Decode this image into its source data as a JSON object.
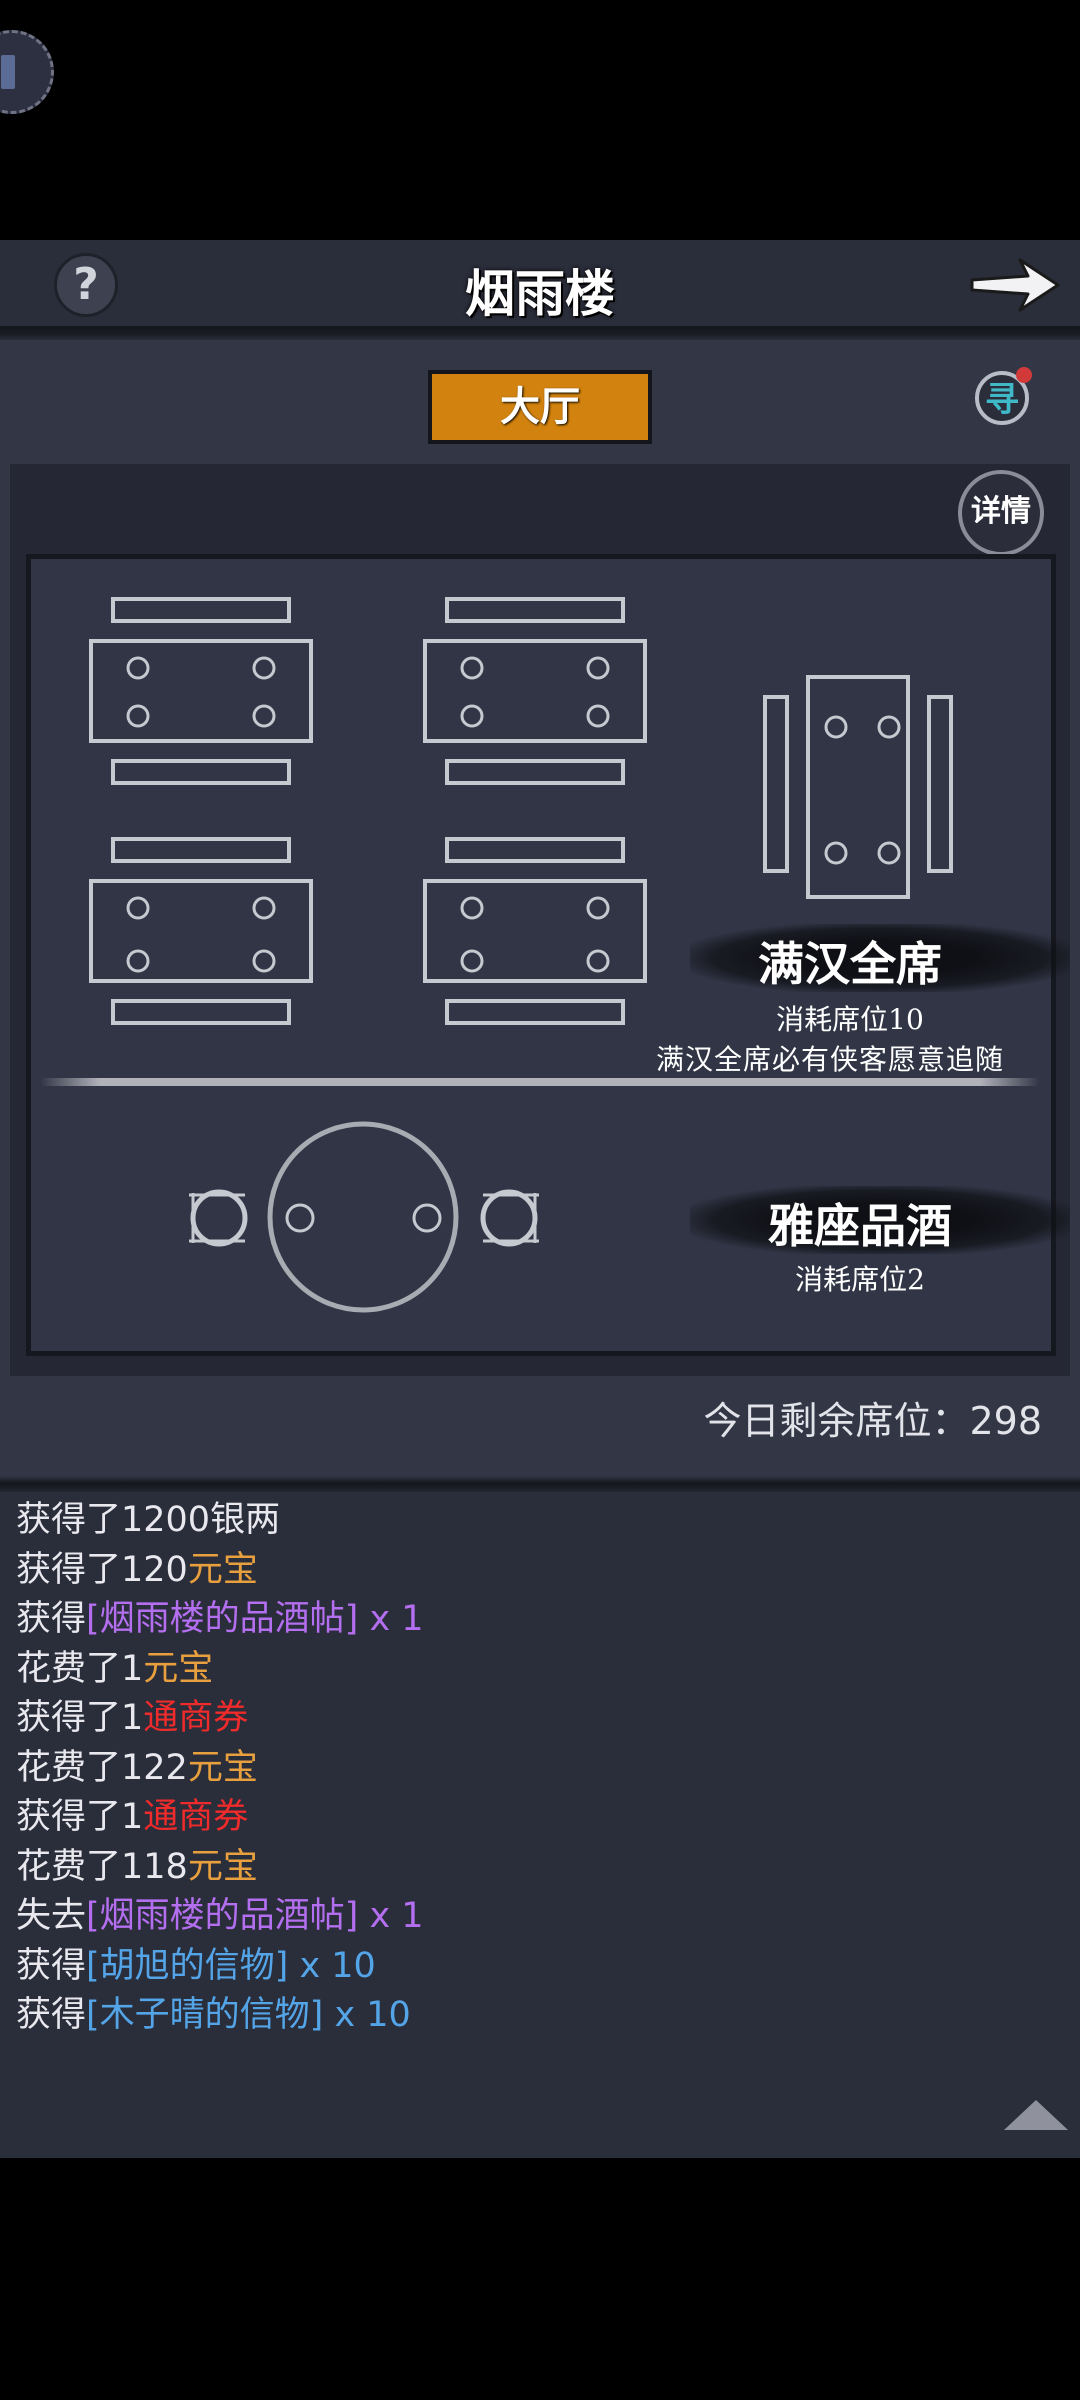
{
  "header": {
    "title": "烟雨楼",
    "help_icon": "question-mark-icon",
    "back_icon": "right-arrow-icon"
  },
  "tab": {
    "label": "大厅",
    "color": "#d2820e"
  },
  "search_badge": {
    "icon": "search-badge-icon",
    "glyph": "寻",
    "has_notification_dot": true
  },
  "details_button": {
    "label": "详情"
  },
  "feast": {
    "title": "满汉全席",
    "cost": "消耗席位10",
    "description": "满汉全席必有侠客愿意追随"
  },
  "wine": {
    "title": "雅座品酒",
    "cost": "消耗席位2"
  },
  "seats": {
    "label": "今日剩余席位：",
    "value": "298"
  },
  "log": [
    [
      {
        "text": "获得了1200银两",
        "color": "white"
      }
    ],
    [
      {
        "text": "获得了120",
        "color": "white"
      },
      {
        "text": "元宝",
        "color": "gold"
      }
    ],
    [
      {
        "text": "获得",
        "color": "white"
      },
      {
        "text": "[烟雨楼的品酒帖] x 1",
        "color": "purple"
      }
    ],
    [
      {
        "text": "花费了1",
        "color": "white"
      },
      {
        "text": "元宝",
        "color": "gold"
      }
    ],
    [
      {
        "text": "获得了1",
        "color": "white"
      },
      {
        "text": "通商券",
        "color": "red"
      }
    ],
    [
      {
        "text": "花费了122",
        "color": "white"
      },
      {
        "text": "元宝",
        "color": "gold"
      }
    ],
    [
      {
        "text": "获得了1",
        "color": "white"
      },
      {
        "text": "通商券",
        "color": "red"
      }
    ],
    [
      {
        "text": "花费了118",
        "color": "white"
      },
      {
        "text": "元宝",
        "color": "gold"
      }
    ],
    [
      {
        "text": "失去",
        "color": "white"
      },
      {
        "text": "[烟雨楼的品酒帖] x 1",
        "color": "purple"
      }
    ],
    [
      {
        "text": "获得",
        "color": "white"
      },
      {
        "text": "[胡旭的信物] x 10",
        "color": "blue"
      }
    ],
    [
      {
        "text": "获得",
        "color": "white"
      },
      {
        "text": "[木子晴的信物] x 10",
        "color": "blue"
      }
    ]
  ],
  "colors": {
    "white": "#e8e8ee",
    "gold": "#e8a03e",
    "red": "#ef2b2b",
    "purple": "#b46ef0",
    "blue": "#54a4e8",
    "accent": "#d2820e"
  },
  "scroll_icon": "scroll-up-triangle-icon"
}
